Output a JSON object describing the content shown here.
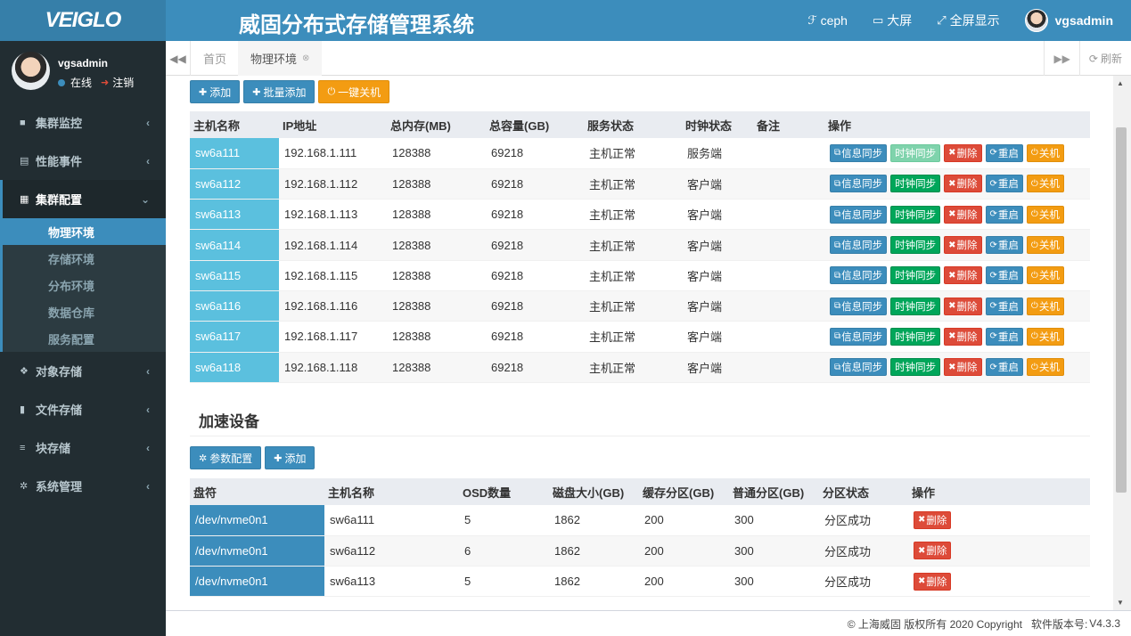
{
  "header": {
    "logo": "VEIGLO",
    "title": "威固分布式存储管理系统",
    "nav": [
      {
        "icon": "ceph-icon",
        "label": "ceph"
      },
      {
        "icon": "monitor-icon",
        "label": "大屏"
      },
      {
        "icon": "fullscreen-icon",
        "label": "全屏显示"
      }
    ],
    "user": "vgsadmin"
  },
  "sidebar": {
    "user_name": "vgsadmin",
    "status": "在线",
    "logout": "注销",
    "menu": [
      {
        "label": "集群监控"
      },
      {
        "label": "性能事件"
      },
      {
        "label": "集群配置"
      },
      {
        "label": "对象存储"
      },
      {
        "label": "文件存储"
      },
      {
        "label": "块存储"
      },
      {
        "label": "系统管理"
      }
    ],
    "submenu": [
      "物理环境",
      "存储环境",
      "分布环境",
      "数据仓库",
      "服务配置"
    ]
  },
  "tabs": {
    "home": "首页",
    "active": "物理环境",
    "refresh": "刷新"
  },
  "hosts": {
    "toolbar": {
      "add": "添加",
      "batch_add": "批量添加",
      "shutdown_all": "一键关机"
    },
    "columns": [
      "主机名称",
      "IP地址",
      "总内存(MB)",
      "总容量(GB)",
      "服务状态",
      "时钟状态",
      "备注",
      "操作"
    ],
    "actions": {
      "sync_info": "信息同步",
      "sync_clock": "时钟同步",
      "delete": "删除",
      "restart": "重启",
      "shutdown": "关机"
    },
    "rows": [
      {
        "name": "sw6a111",
        "ip": "192.168.1.111",
        "mem": "128388",
        "cap": "69218",
        "svc": "主机正常",
        "clock": "服务端",
        "note": ""
      },
      {
        "name": "sw6a112",
        "ip": "192.168.1.112",
        "mem": "128388",
        "cap": "69218",
        "svc": "主机正常",
        "clock": "客户端",
        "note": ""
      },
      {
        "name": "sw6a113",
        "ip": "192.168.1.113",
        "mem": "128388",
        "cap": "69218",
        "svc": "主机正常",
        "clock": "客户端",
        "note": ""
      },
      {
        "name": "sw6a114",
        "ip": "192.168.1.114",
        "mem": "128388",
        "cap": "69218",
        "svc": "主机正常",
        "clock": "客户端",
        "note": ""
      },
      {
        "name": "sw6a115",
        "ip": "192.168.1.115",
        "mem": "128388",
        "cap": "69218",
        "svc": "主机正常",
        "clock": "客户端",
        "note": ""
      },
      {
        "name": "sw6a116",
        "ip": "192.168.1.116",
        "mem": "128388",
        "cap": "69218",
        "svc": "主机正常",
        "clock": "客户端",
        "note": ""
      },
      {
        "name": "sw6a117",
        "ip": "192.168.1.117",
        "mem": "128388",
        "cap": "69218",
        "svc": "主机正常",
        "clock": "客户端",
        "note": ""
      },
      {
        "name": "sw6a118",
        "ip": "192.168.1.118",
        "mem": "128388",
        "cap": "69218",
        "svc": "主机正常",
        "clock": "客户端",
        "note": ""
      }
    ]
  },
  "accel": {
    "title": "加速设备",
    "toolbar": {
      "params": "参数配置",
      "add": "添加"
    },
    "columns": [
      "盘符",
      "主机名称",
      "OSD数量",
      "磁盘大小(GB)",
      "缓存分区(GB)",
      "普通分区(GB)",
      "分区状态",
      "操作"
    ],
    "delete": "删除",
    "rows": [
      {
        "dev": "/dev/nvme0n1",
        "host": "sw6a111",
        "osd": "5",
        "size": "1862",
        "cache": "200",
        "normal": "300",
        "status": "分区成功"
      },
      {
        "dev": "/dev/nvme0n1",
        "host": "sw6a112",
        "osd": "6",
        "size": "1862",
        "cache": "200",
        "normal": "300",
        "status": "分区成功"
      },
      {
        "dev": "/dev/nvme0n1",
        "host": "sw6a113",
        "osd": "5",
        "size": "1862",
        "cache": "200",
        "normal": "300",
        "status": "分区成功"
      }
    ]
  },
  "footer": {
    "copyright": "© 上海威固 版权所有 2020 Copyright",
    "version_label": "软件版本号:",
    "version": "V4.3.3"
  },
  "colors": {
    "primary": "#3c8dbc",
    "sidebar": "#222d32",
    "info": "#5bc0de",
    "success": "#00a65a",
    "danger": "#dd4b39",
    "warning": "#f39c12"
  }
}
